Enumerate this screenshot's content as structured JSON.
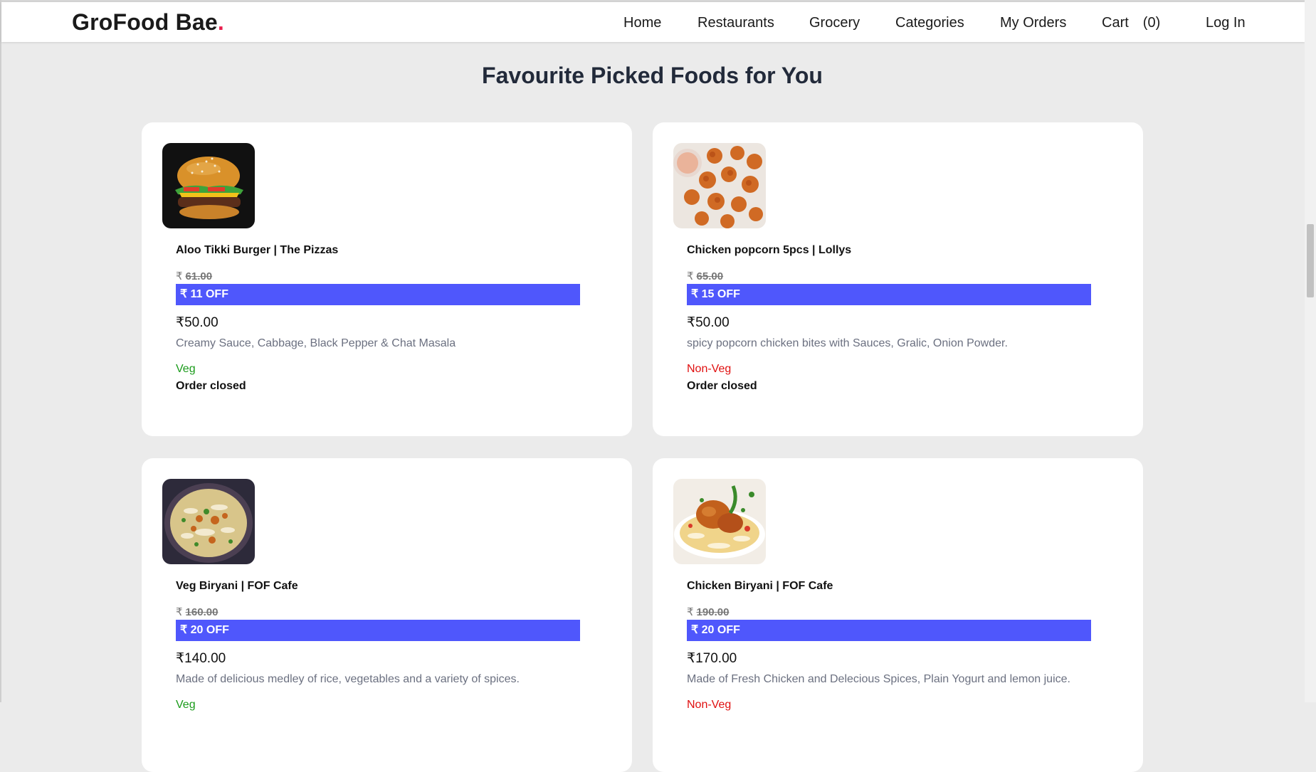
{
  "brand": {
    "name": "GroFood Bae",
    "dot": "."
  },
  "nav": {
    "home": "Home",
    "restaurants": "Restaurants",
    "grocery": "Grocery",
    "categories": "Categories",
    "my_orders": "My Orders",
    "cart": "Cart",
    "cart_count": "(0)",
    "login": "Log In"
  },
  "section_title": "Favourite Picked Foods for You",
  "currency": "₹",
  "foods": [
    {
      "image": "burger-image",
      "name": "Aloo Tikki Burger | The Pizzas",
      "old_price": "61.00",
      "discount": "₹ 11 OFF",
      "price": "₹50.00",
      "description": "Creamy Sauce, Cabbage, Black Pepper & Chat Masala",
      "type": "Veg",
      "status": "Order closed"
    },
    {
      "image": "chicken-popcorn-image",
      "name": "Chicken popcorn 5pcs | Lollys",
      "old_price": "65.00",
      "discount": "₹ 15 OFF",
      "price": "₹50.00",
      "description": "spicy popcorn chicken bites with Sauces, Gralic, Onion Powder.",
      "type": "Non-Veg",
      "status": "Order closed"
    },
    {
      "image": "veg-biryani-image",
      "name": "Veg Biryani | FOF Cafe",
      "old_price": "160.00",
      "discount": "₹ 20 OFF",
      "price": "₹140.00",
      "description": "Made of delicious medley of rice, vegetables and a variety of spices.",
      "type": "Veg",
      "status": ""
    },
    {
      "image": "chicken-biryani-image",
      "name": "Chicken Biryani | FOF Cafe",
      "old_price": "190.00",
      "discount": "₹ 20 OFF",
      "price": "₹170.00",
      "description": "Made of Fresh Chicken and Delecious Spices, Plain Yogurt and lemon juice.",
      "type": "Non-Veg",
      "status": ""
    }
  ],
  "colors": {
    "brand_dot": "#e91e4d",
    "discount_bg": "#4f57fc",
    "veg": "#1a9b1a",
    "non_veg": "#e01010",
    "page_bg": "#ebebeb"
  }
}
